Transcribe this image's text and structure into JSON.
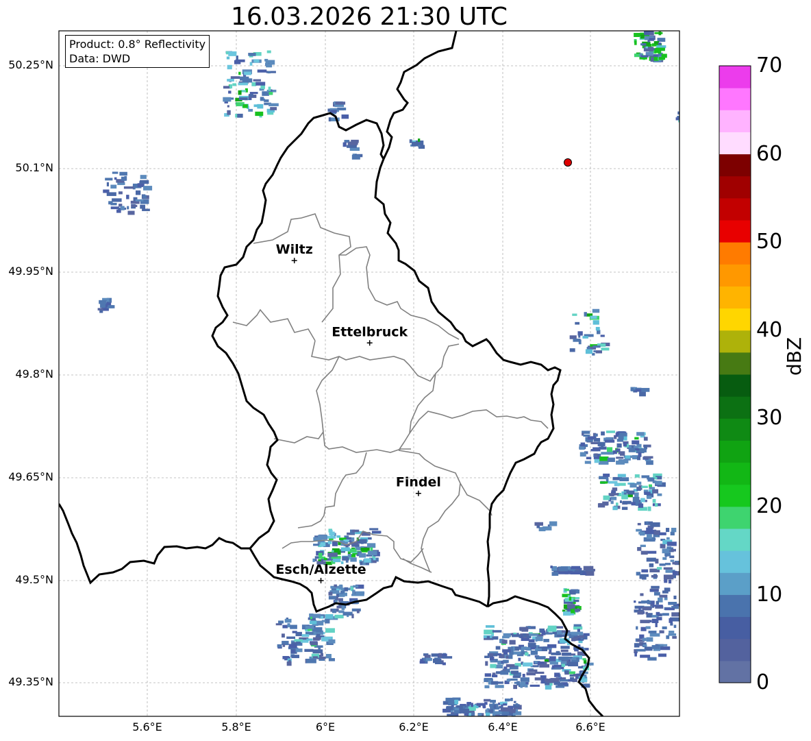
{
  "title": "16.03.2026 21:30 UTC",
  "info": {
    "product": "Product: 0.8° Reflectivity",
    "data_source": "Data: DWD"
  },
  "axes": {
    "lat_labels": [
      "50.25°N",
      "50.1°N",
      "49.95°N",
      "49.8°N",
      "49.65°N",
      "49.5°N",
      "49.35°N"
    ],
    "lon_labels": [
      "5.6°E",
      "5.8°E",
      "6°E",
      "6.2°E",
      "6.4°E",
      "6.6°E"
    ]
  },
  "places": [
    {
      "name": "Wiltz",
      "lon": 5.93,
      "lat": 49.966
    },
    {
      "name": "Ettelbruck",
      "lon": 6.1,
      "lat": 49.846
    },
    {
      "name": "Findel",
      "lon": 6.21,
      "lat": 49.627
    },
    {
      "name": "Esch/Alzette",
      "lon": 5.99,
      "lat": 49.5
    }
  ],
  "marker": {
    "lon": 6.555,
    "lat": 50.11,
    "color": "#dd0000"
  },
  "colorbar": {
    "label": "dBZ",
    "ticks": [
      "0",
      "10",
      "20",
      "30",
      "40",
      "50",
      "60",
      "70"
    ],
    "colors": [
      "#6272a4",
      "#53629e",
      "#475ea2",
      "#4a73ad",
      "#5b9fc8",
      "#66c2dc",
      "#64d7c6",
      "#3ed46f",
      "#16c81e",
      "#12b715",
      "#10a312",
      "#0f8a14",
      "#0c7113",
      "#075c10",
      "#477a13",
      "#aeb20a",
      "#ffd600",
      "#ffb400",
      "#ff9800",
      "#ff7b00",
      "#e80000",
      "#c20000",
      "#a00000",
      "#7d0000",
      "#ffdcff",
      "#ffb3ff",
      "#ff77ff",
      "#ec3cec"
    ]
  }
}
